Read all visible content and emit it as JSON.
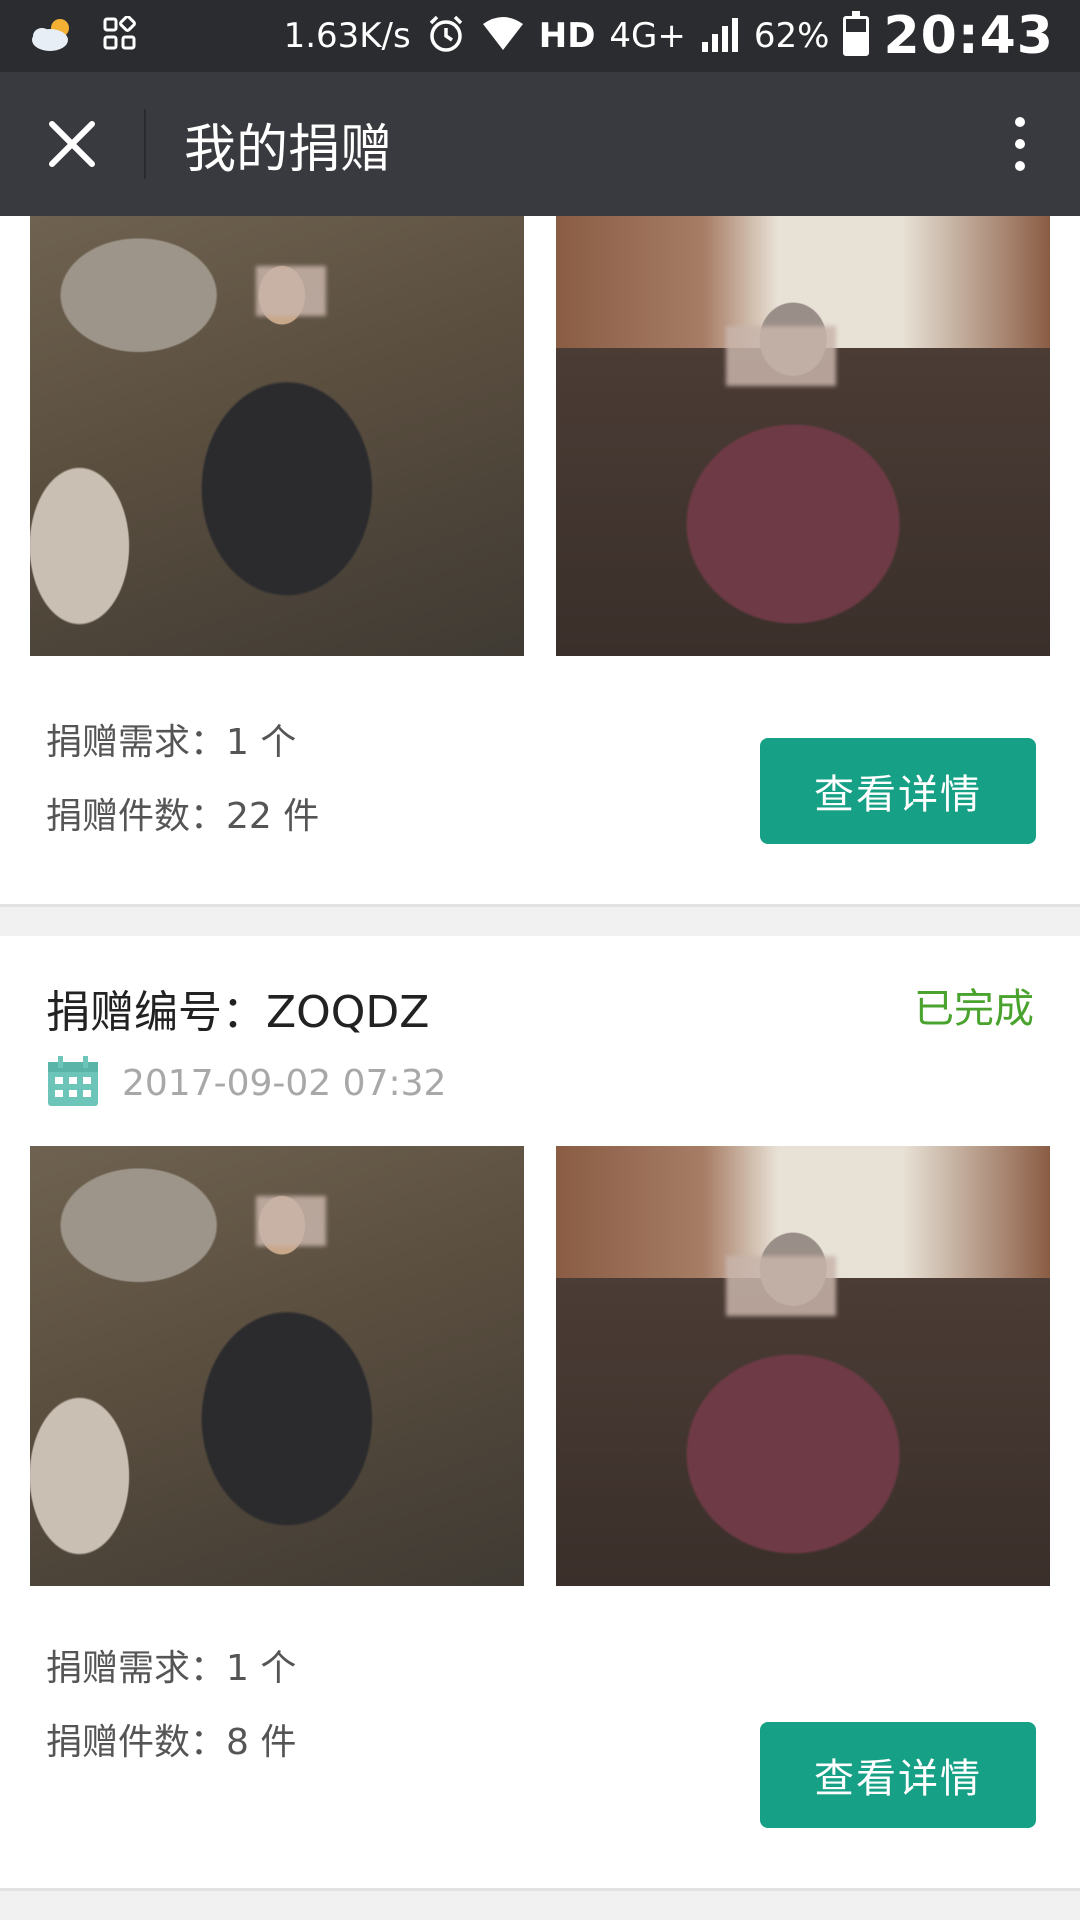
{
  "status_bar": {
    "network_speed": "1.63K/s",
    "hd_label": "HD",
    "network_type": "4G+",
    "battery_percent": "62%",
    "battery_level": 0.62,
    "time": "20:43"
  },
  "title_bar": {
    "title": "我的捐赠"
  },
  "donations": [
    {
      "demand_label": "捐赠需求：",
      "demand_value": "1 个",
      "count_label": "捐赠件数：",
      "count_value": "22 件",
      "detail_button": "查看详情"
    },
    {
      "id_label": "捐赠编号：",
      "id_value": "ZOQDZ",
      "status": "已完成",
      "date": "2017-09-02 07:32",
      "demand_label": "捐赠需求：",
      "demand_value": "1 个",
      "count_label": "捐赠件数：",
      "count_value": "8 件",
      "detail_button": "查看详情"
    }
  ],
  "colors": {
    "status_bar_bg": "#2b2c2f",
    "title_bar_bg": "#393a3f",
    "button_green": "#16a085",
    "status_green": "#4aa32e",
    "calendar_teal": "#6cc5b8"
  }
}
